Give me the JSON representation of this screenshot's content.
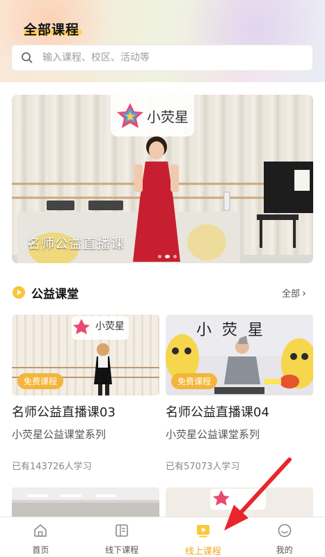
{
  "header": {
    "title": "全部课程",
    "search_placeholder": "输入课程、校区、活动等"
  },
  "banner": {
    "title": "名师公益直播课",
    "logo_text": "小荧星",
    "slide_count": 3,
    "active_slide": 2
  },
  "section": {
    "title": "公益课堂",
    "more_label": "全部",
    "more_chevron": "›"
  },
  "courses": [
    {
      "badge": "免费课程",
      "title": "名师公益直播课03",
      "subtitle": "小荧星公益课堂系列",
      "count": "已有143726人学习",
      "logo_text": "小荧星"
    },
    {
      "badge": "免费课程",
      "title": "名师公益直播课04",
      "subtitle": "小荧星公益课堂系列",
      "count": "已有57073人学习",
      "logo_text": "小 荧 星"
    }
  ],
  "tabbar": {
    "items": [
      {
        "label": "首页",
        "icon": "home-icon",
        "active": false
      },
      {
        "label": "线下课程",
        "icon": "offline-course-icon",
        "active": false
      },
      {
        "label": "线上课程",
        "icon": "online-course-icon",
        "active": true
      },
      {
        "label": "我的",
        "icon": "profile-icon",
        "active": false
      }
    ]
  },
  "colors": {
    "accent": "#f3a91e",
    "badge": "#f3b63a",
    "title_highlight": "#ffd23c",
    "annotation_arrow": "#e8262b"
  }
}
